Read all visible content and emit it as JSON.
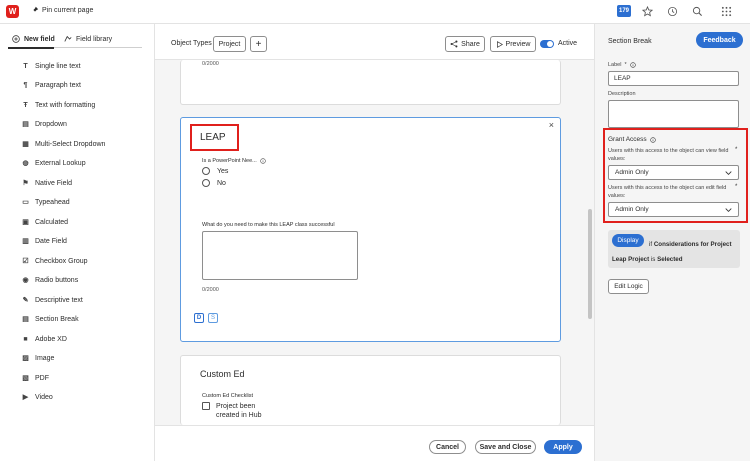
{
  "topbar": {
    "logo_letter": "W",
    "pin_label": "Pin current page",
    "badge_count": "179"
  },
  "left_panel": {
    "tabs": [
      {
        "label": "New field",
        "active": true
      },
      {
        "label": "Field library",
        "active": false
      }
    ],
    "field_types": [
      {
        "label": "Single line text",
        "icon": "text-t-icon"
      },
      {
        "label": "Paragraph text",
        "icon": "paragraph-icon"
      },
      {
        "label": "Text with formatting",
        "icon": "rich-text-icon"
      },
      {
        "label": "Dropdown",
        "icon": "dropdown-icon"
      },
      {
        "label": "Multi-Select Dropdown",
        "icon": "multi-select-icon"
      },
      {
        "label": "External Lookup",
        "icon": "globe-icon"
      },
      {
        "label": "Native Field",
        "icon": "native-field-icon"
      },
      {
        "label": "Typeahead",
        "icon": "typeahead-icon"
      },
      {
        "label": "Calculated",
        "icon": "calculator-icon"
      },
      {
        "label": "Date Field",
        "icon": "calendar-icon"
      },
      {
        "label": "Checkbox Group",
        "icon": "checkbox-icon"
      },
      {
        "label": "Radio buttons",
        "icon": "radio-icon"
      },
      {
        "label": "Descriptive text",
        "icon": "descriptive-text-icon"
      },
      {
        "label": "Section Break",
        "icon": "section-break-icon"
      },
      {
        "label": "Adobe XD",
        "icon": "adobe-xd-icon"
      },
      {
        "label": "Image",
        "icon": "image-icon"
      },
      {
        "label": "PDF",
        "icon": "pdf-icon"
      },
      {
        "label": "Video",
        "icon": "video-icon"
      }
    ]
  },
  "toolbar": {
    "object_types_label": "Object Types",
    "object_type_chip": "Project",
    "add_label": "+",
    "share_label": "Share",
    "preview_label": "Preview",
    "active_label": "Active"
  },
  "form": {
    "prev_counter": "0/2000",
    "section_title": "LEAP",
    "question1_label": "Is a PowerPoint Nee...",
    "question1_options": [
      "Yes",
      "No"
    ],
    "question2_label": "What do you need to make this LEAP class successful",
    "question2_counter": "0/2000",
    "chips": [
      "D",
      "S"
    ],
    "close_glyph": "×",
    "next_section_title": "Custom Ed",
    "next_checklist_label": "Custom Ed Checklist",
    "next_checklist_item": "Project been created in Hub"
  },
  "footer": {
    "cancel_label": "Cancel",
    "save_close_label": "Save and Close",
    "apply_label": "Apply"
  },
  "right_panel": {
    "title": "Section Break",
    "feedback_label": "Feedback",
    "label_caption": "Label",
    "required_mark": "*",
    "label_value": "LEAP",
    "description_caption": "Description",
    "grant_access_title": "Grant Access",
    "view_caption": "Users with this access to the object can view field values:",
    "view_value": "Admin Only",
    "edit_caption": "Users with this access to the object can edit field values:",
    "edit_value": "Admin Only",
    "display_button": "Display",
    "logic_if": "if",
    "logic_field": "Considerations for Project Leap Project",
    "logic_is": "is",
    "logic_value": "Selected",
    "edit_logic_label": "Edit Logic"
  },
  "colors": {
    "accent_blue": "#2c6fd1",
    "highlight_red": "#e0201c",
    "logo_red": "#e0201c"
  }
}
